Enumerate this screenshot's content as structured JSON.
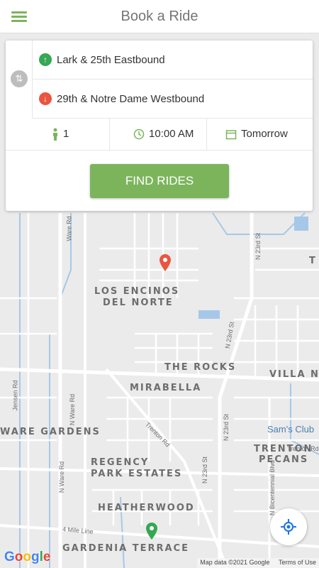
{
  "app": {
    "title": "Book a Ride",
    "accent": "#7cb45c"
  },
  "trip": {
    "from": "Lark & 25th Eastbound",
    "to": "29th & Notre Dame Westbound",
    "passengers": "1",
    "time": "10:00 AM",
    "date": "Tomorrow",
    "find_label": "FIND RIDES"
  },
  "map": {
    "neighborhoods": {
      "los_encinos_1": "LOS ENCINOS",
      "los_encinos_2": "DEL NORTE",
      "the_rocks": "THE ROCKS",
      "villa_n": "VILLA N",
      "mirabella": "MIRABELLA",
      "ware_gardens": "WARE GARDENS",
      "trenton_1": "TRENTON",
      "trenton_2": "PECANS",
      "regency_1": "REGENCY",
      "regency_2": "PARK ESTATES",
      "heatherwood": "HEATHERWOOD",
      "gardenia": "GARDENIA TERRACE",
      "t_edge": "T"
    },
    "streets": {
      "ware_rd_1": "Ware Rd",
      "ware_rd_2": "N Ware Rd",
      "ware_rd_3": "N Ware Rd",
      "n23_1": "N 23rd St",
      "n23_2": "N 23rd St",
      "n23_3": "N 23rd St",
      "n23_4": "N 23rd St",
      "trenton_rd_1": "Trenton Rd",
      "trenton_rd_2": "Trenton Rd",
      "bicentennial": "N Bicentennial Blvd",
      "four_mile": "4 Mile Line",
      "jensen": "Jensen Rd"
    },
    "poi": "Sam's Club",
    "attribution_data": "Map data ©2021 Google",
    "attribution_terms": "Terms of Use",
    "logo": "Google"
  },
  "icons": {
    "menu": "menu-icon",
    "swap": "swap-icon",
    "from": "arrow-up-icon",
    "to": "arrow-down-icon",
    "passenger": "person-icon",
    "time": "clock-icon",
    "date": "calendar-icon",
    "locate": "crosshair-icon"
  }
}
